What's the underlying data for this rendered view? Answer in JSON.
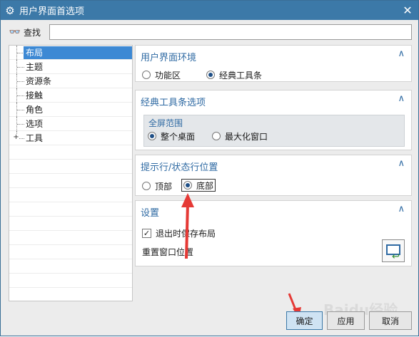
{
  "window": {
    "title": "用户界面首选项"
  },
  "search": {
    "label": "查找",
    "value": "",
    "placeholder": ""
  },
  "tree": {
    "items": [
      {
        "label": "布局",
        "selected": true,
        "expandable": false
      },
      {
        "label": "主题",
        "selected": false,
        "expandable": false
      },
      {
        "label": "资源条",
        "selected": false,
        "expandable": false
      },
      {
        "label": "接触",
        "selected": false,
        "expandable": false
      },
      {
        "label": "角色",
        "selected": false,
        "expandable": false
      },
      {
        "label": "选项",
        "selected": false,
        "expandable": false
      },
      {
        "label": "工具",
        "selected": false,
        "expandable": true
      }
    ]
  },
  "sections": {
    "ui_env": {
      "title": "用户界面环境",
      "options": [
        "功能区",
        "经典工具条"
      ],
      "selected": "经典工具条"
    },
    "classic": {
      "title": "经典工具条选项",
      "subgroup_title": "全屏范围",
      "options": [
        "整个桌面",
        "最大化窗口"
      ],
      "selected": "整个桌面"
    },
    "prompt": {
      "title": "提示行/状态行位置",
      "options": [
        "顶部",
        "底部"
      ],
      "selected": "底部"
    },
    "settings": {
      "title": "设置",
      "checkbox_label": "退出时保存布局",
      "checkbox_checked": true,
      "reset_label": "重置窗口位置"
    }
  },
  "buttons": {
    "ok": "确定",
    "apply": "应用",
    "cancel": "取消"
  },
  "watermark": "Baidu经验",
  "colors": {
    "accent": "#3c79a8",
    "section_title": "#2f6aa3",
    "selection": "#3d89d4",
    "annotation_arrow": "#e53935"
  }
}
